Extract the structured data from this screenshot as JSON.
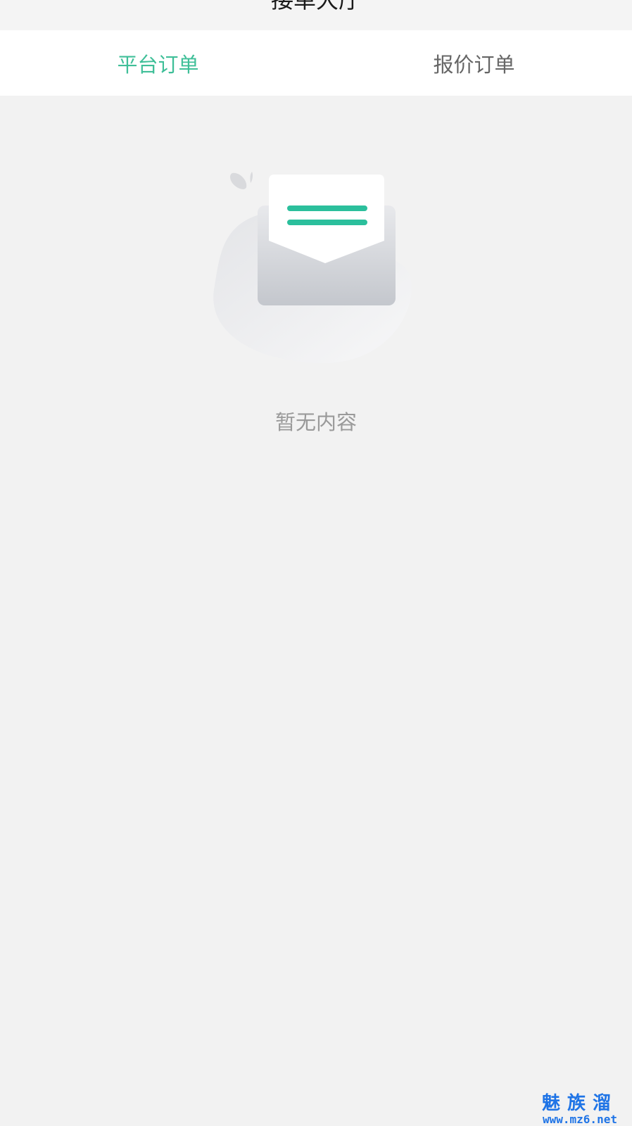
{
  "header": {
    "title": "接单大厅"
  },
  "tabs": [
    {
      "label": "平台订单",
      "active": true
    },
    {
      "label": "报价订单",
      "active": false
    }
  ],
  "empty_state": {
    "message": "暂无内容",
    "icon": "empty-mail-icon"
  },
  "watermark": {
    "title": "魅族溜",
    "url": "www.mz6.net"
  },
  "colors": {
    "accent": "#3fbf98",
    "tab_inactive": "#666666",
    "background": "#f2f2f2"
  }
}
